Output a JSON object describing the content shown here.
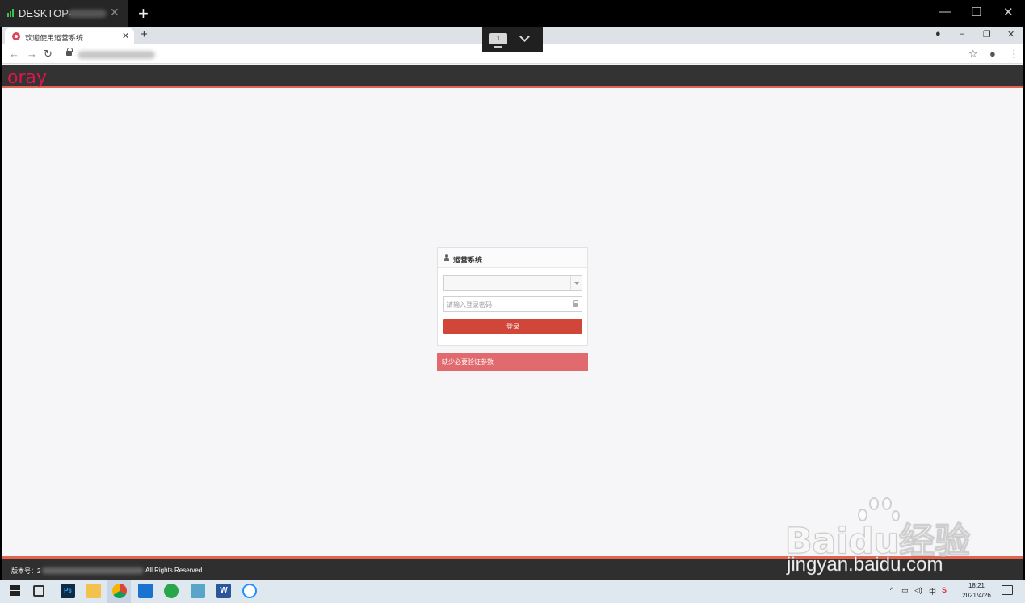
{
  "remote_window": {
    "tab_title": "DESKTOP-",
    "new_tab": "+",
    "minimize": "—",
    "maximize": "☐",
    "close": "✕"
  },
  "browser": {
    "tab_title": "欢迎使用运营系统",
    "new_tab": "+",
    "remote_monitor_label": "1"
  },
  "site": {
    "logo": "oray",
    "login_title": "运营系统",
    "password_placeholder": "请输入登录密码",
    "login_button": "登录",
    "error_message": "缺少必要验证参数",
    "footer_version_label": "版本号：2",
    "footer_rights": "All Rights Reserved."
  },
  "watermark": {
    "brand": "Baidu经验",
    "site": "jingyan.baidu.com"
  },
  "taskbar": {
    "time": "18:21",
    "date": "2021/4/26",
    "ime": "中"
  },
  "colors": {
    "accent": "#e2644f",
    "logo": "#e0144c",
    "button": "#d0473a",
    "error": "#e06a6e"
  }
}
